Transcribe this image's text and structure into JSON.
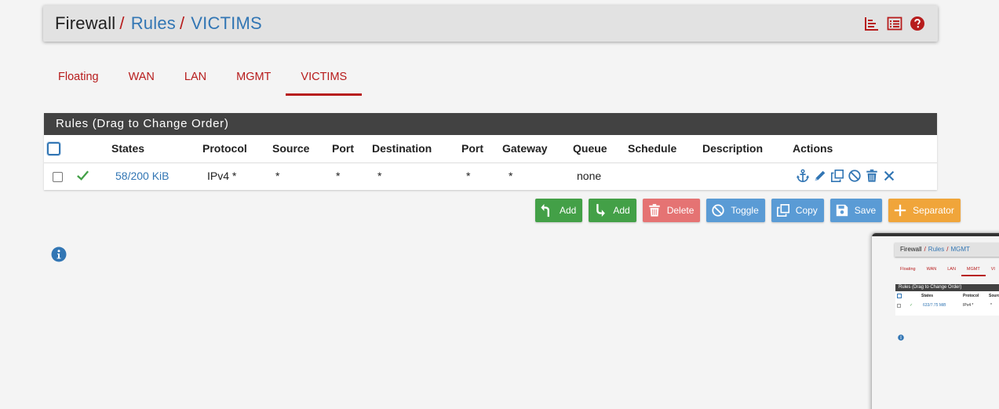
{
  "breadcrumb": {
    "root": "Firewall",
    "section": "Rules",
    "current": "VICTIMS",
    "separator": "/"
  },
  "header_icons": [
    "chart-icon",
    "list-icon",
    "help-icon"
  ],
  "tabs": [
    {
      "label": "Floating",
      "active": false
    },
    {
      "label": "WAN",
      "active": false
    },
    {
      "label": "LAN",
      "active": false
    },
    {
      "label": "MGMT",
      "active": false
    },
    {
      "label": "VICTIMS",
      "active": true
    }
  ],
  "rules_panel": {
    "title": "Rules (Drag to Change Order)",
    "columns": [
      "States",
      "Protocol",
      "Source",
      "Port",
      "Destination",
      "Port",
      "Gateway",
      "Queue",
      "Schedule",
      "Description",
      "Actions"
    ],
    "rows": [
      {
        "states": "58/200 KiB",
        "protocol": "IPv4 *",
        "source": "*",
        "source_port": "*",
        "destination": "*",
        "destination_port": "*",
        "gateway": "*",
        "queue": "none",
        "schedule": "",
        "description": ""
      }
    ]
  },
  "buttons": {
    "add_top": "Add",
    "add_bottom": "Add",
    "delete": "Delete",
    "toggle": "Toggle",
    "copy": "Copy",
    "save": "Save",
    "separator": "Separator"
  },
  "colors": {
    "accent_red": "#b71c1c",
    "link_blue": "#3276b4",
    "panel_dark": "#424242",
    "green": "#43a047",
    "delete_red": "#e57373",
    "action_blue": "#5a9bd5",
    "orange": "#f0a53a"
  },
  "thumbnail": {
    "breadcrumb_root": "Firewall",
    "breadcrumb_section": "Rules",
    "breadcrumb_current": "MGMT",
    "tabs": [
      "Floating",
      "WAN",
      "LAN",
      "MGMT",
      "VI"
    ],
    "panel_title": "Rules (Drag to Change Order)",
    "col_states": "States",
    "col_protocol": "Protocol",
    "col_source": "Sourc",
    "row_states": "633/7.75 MiB",
    "row_protocol": "IPv4 *",
    "row_source": "*"
  }
}
